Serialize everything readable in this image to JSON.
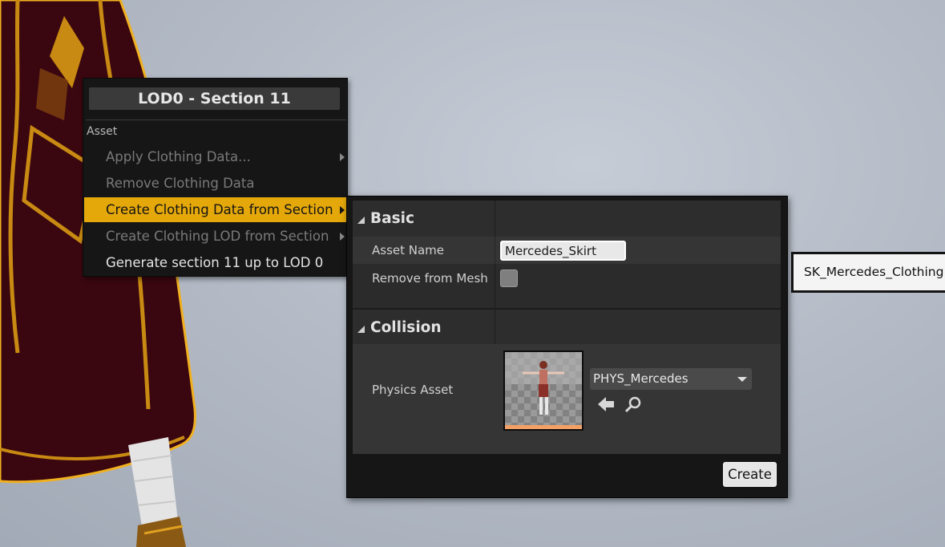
{
  "context_menu": {
    "title": "LOD0 - Section 11",
    "section_label": "Asset",
    "items": [
      {
        "label": "Apply Clothing Data...",
        "enabled": false,
        "highlighted": false,
        "has_submenu": true
      },
      {
        "label": "Remove Clothing Data",
        "enabled": false,
        "highlighted": false,
        "has_submenu": false
      },
      {
        "label": "Create Clothing Data from Section",
        "enabled": true,
        "highlighted": true,
        "has_submenu": true
      },
      {
        "label": "Create Clothing LOD from Section",
        "enabled": false,
        "highlighted": false,
        "has_submenu": true
      },
      {
        "label": "Generate section 11 up to LOD 0",
        "enabled": true,
        "highlighted": false,
        "has_submenu": false
      }
    ]
  },
  "create_panel": {
    "basic": {
      "title": "Basic",
      "asset_name_label": "Asset Name",
      "asset_name_value": "Mercedes_Skirt",
      "remove_from_mesh_label": "Remove from Mesh",
      "remove_from_mesh_checked": false
    },
    "collision": {
      "title": "Collision",
      "physics_asset_label": "Physics Asset",
      "physics_asset_value": "PHYS_Mercedes"
    },
    "create_label": "Create"
  },
  "asset_tag": "SK_Mercedes_Clothing",
  "icons": {
    "collapse": "triangle-down-icon",
    "submenu": "chevron-right-icon",
    "use_selected": "arrow-left-icon",
    "browse": "magnifier-icon",
    "combo": "caret-down-icon"
  },
  "colors": {
    "menu_highlight": "#e5a80a",
    "menu_bg": "#161616",
    "panel_bg": "#2b2b2b",
    "viewport_bg": "#b4bbc6",
    "cloth_dark": "#3a0710",
    "cloth_trim": "#e8a418"
  }
}
